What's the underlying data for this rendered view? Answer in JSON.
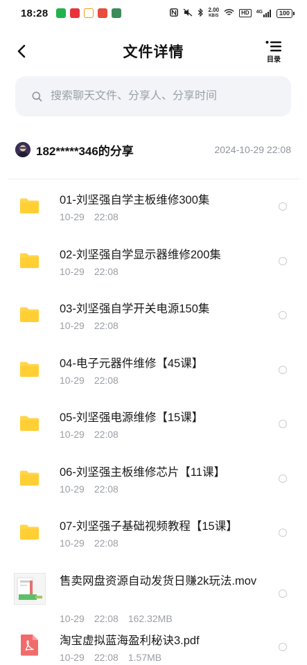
{
  "status_bar": {
    "time": "18:28",
    "net_speed_value": "2.00",
    "net_speed_unit": "KB/S",
    "hd": "HD",
    "signal_label": "4G",
    "battery": "100"
  },
  "header": {
    "title": "文件详情",
    "toc_label": "目录"
  },
  "search": {
    "placeholder": "搜索聊天文件、分享人、分享时间"
  },
  "share": {
    "title": "182*****346的分享",
    "time": "2024-10-29  22:08"
  },
  "files": [
    {
      "name": "01-刘坚强自学主板维修300集",
      "date": "10-29",
      "time": "22:08",
      "size": "",
      "icon": "folder-icon"
    },
    {
      "name": "02-刘坚强自学显示器维修200集",
      "date": "10-29",
      "time": "22:08",
      "size": "",
      "icon": "folder-icon"
    },
    {
      "name": "03-刘坚强自学开关电源150集",
      "date": "10-29",
      "time": "22:08",
      "size": "",
      "icon": "folder-icon"
    },
    {
      "name": "04-电子元器件维修【45课】",
      "date": "10-29",
      "time": "22:08",
      "size": "",
      "icon": "folder-icon"
    },
    {
      "name": "05-刘坚强电源维修【15课】",
      "date": "10-29",
      "time": "22:08",
      "size": "",
      "icon": "folder-icon"
    },
    {
      "name": "06-刘坚强主板维修芯片【11课】",
      "date": "10-29",
      "time": "22:08",
      "size": "",
      "icon": "folder-icon"
    },
    {
      "name": "07-刘坚强子基础视频教程【15课】",
      "date": "10-29",
      "time": "22:08",
      "size": "",
      "icon": "folder-icon"
    },
    {
      "name": "售卖网盘资源自动发货日赚2k玩法.mov",
      "date": "10-29",
      "time": "22:08",
      "size": "162.32MB",
      "icon": "video-thumbnail"
    },
    {
      "name": "淘宝虚拟蓝海盈利秘诀3.pdf",
      "date": "10-29",
      "time": "22:08",
      "size": "1.57MB",
      "icon": "pdf-icon"
    }
  ],
  "colors": {
    "folder": "#FFD54A",
    "pdf": "#F26B6B",
    "search_bg": "#F2F4F8",
    "meta_text": "#9A9EA4"
  }
}
